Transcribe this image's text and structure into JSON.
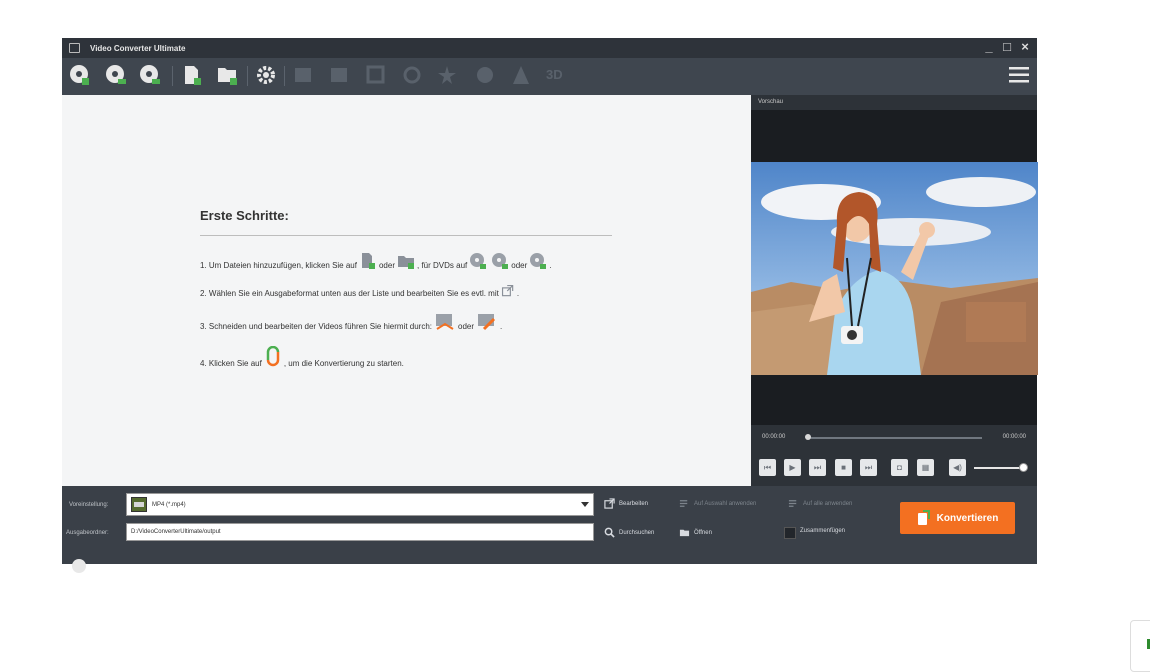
{
  "window": {
    "title": "Video Converter Ultimate",
    "controls": {
      "minimize": "_",
      "maximize": "□",
      "close": "×"
    }
  },
  "toolbar": {
    "buttons": [
      "load-dvd-icon",
      "load-dvd-folder-icon",
      "load-iso-icon",
      "add-file-icon",
      "add-folder-icon",
      "settings-gear-icon",
      "clip-icon",
      "edit-icon",
      "crop-icon",
      "rotate-icon",
      "effect-icon",
      "watermark-icon",
      "text-icon",
      "3d-icon"
    ],
    "label_3d": "3D",
    "menu_icon": "hamburger-menu-icon"
  },
  "getting_started": {
    "title": "Erste Schritte:",
    "step1_a": "1. Um Dateien hinzuzufügen, klicken Sie auf",
    "step1_b": "oder",
    "step1_c": ", für DVDs auf",
    "step1_d": "oder",
    "step1_e": ".",
    "step2_a": "2. Wählen Sie ein Ausgabeformat unten aus der Liste und bearbeiten Sie es evtl. mit",
    "step2_b": ".",
    "step3_a": "3. Schneiden und bearbeiten der Videos führen Sie hiermit durch:",
    "step3_b": "oder",
    "step3_c": ".",
    "step4_a": "4. Klicken Sie auf",
    "step4_b": ", um die Konvertierung zu starten."
  },
  "preview": {
    "label": "Vorschau",
    "time_current": "00:00:00",
    "time_total": "00:00:00",
    "progress": 0,
    "volume": 0.9
  },
  "bottom": {
    "preset_label": "Voreinstellung:",
    "preset_value": "MP4 (*.mp4)",
    "output_label": "Ausgabeordner:",
    "output_value": "D:/VideoConverterUltimate/output",
    "edit_button": "Bearbeiten",
    "apply_selected": "Auf Auswahl anwenden",
    "apply_all": "Auf alle anwenden",
    "browse_button": "Durchsuchen",
    "open_button": "Öffnen",
    "merge_label": "Zusammenfügen",
    "convert_button": "Konvertieren"
  },
  "colors": {
    "accent": "#f37021",
    "title_bar": "#2e333a",
    "toolbar": "#3f464f",
    "icon_green": "#4caf50"
  }
}
